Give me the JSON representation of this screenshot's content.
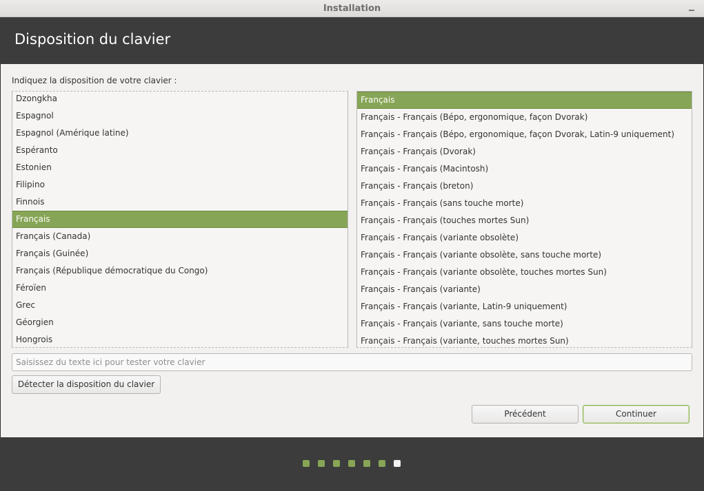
{
  "window": {
    "title": "Installation"
  },
  "header": {
    "title": "Disposition du clavier"
  },
  "prompt": "Indiquez la disposition de votre clavier :",
  "layouts": {
    "items": [
      "Dzongkha",
      "Espagnol",
      "Espagnol (Amérique latine)",
      "Espéranto",
      "Estonien",
      "Filipino",
      "Finnois",
      "Français",
      "Français (Canada)",
      "Français (Guinée)",
      "Français (République démocratique du Congo)",
      "Féroïen",
      "Grec",
      "Géorgien",
      "Hongrois"
    ],
    "selected_index": 7
  },
  "variants": {
    "items": [
      "Français",
      "Français - Français (Bépo, ergonomique, façon Dvorak)",
      "Français - Français (Bépo, ergonomique, façon Dvorak, Latin-9 uniquement)",
      "Français - Français (Dvorak)",
      "Français - Français (Macintosh)",
      "Français - Français (breton)",
      "Français - Français (sans touche morte)",
      "Français - Français (touches mortes Sun)",
      "Français - Français (variante obsolète)",
      "Français - Français (variante obsolète, sans touche morte)",
      "Français - Français (variante obsolète, touches mortes Sun)",
      "Français - Français (variante)",
      "Français - Français (variante, Latin-9 uniquement)",
      "Français - Français (variante, sans touche morte)",
      "Français - Français (variante, touches mortes Sun)"
    ],
    "selected_index": 0
  },
  "test_input": {
    "placeholder": "Saisissez du texte ici pour tester votre clavier",
    "value": ""
  },
  "buttons": {
    "detect": "Détecter la disposition du clavier",
    "previous": "Précédent",
    "continue": "Continuer"
  },
  "progress": {
    "total_steps": 7,
    "current_step": 7
  },
  "colors": {
    "accent": "#87a556",
    "header_bg": "#3c3c3c"
  }
}
